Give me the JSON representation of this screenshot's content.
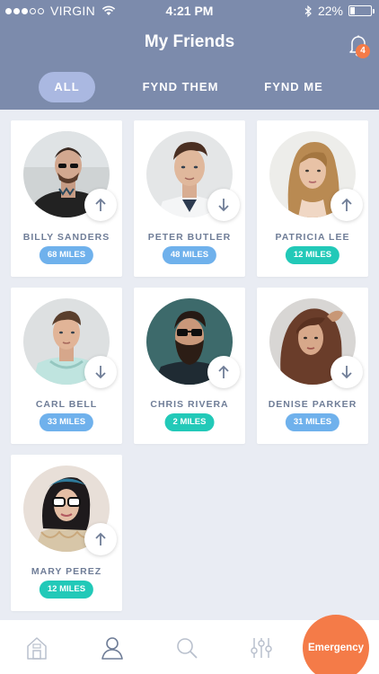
{
  "status_bar": {
    "carrier": "VIRGIN",
    "time": "4:21 PM",
    "battery": "22%",
    "battery_level": 0.22
  },
  "header": {
    "title": "My Friends",
    "notification_count": "4"
  },
  "tabs": [
    {
      "label": "ALL",
      "active": true
    },
    {
      "label": "FYND THEM",
      "active": false
    },
    {
      "label": "FYND ME",
      "active": false
    }
  ],
  "friends": [
    {
      "name": "BILLY SANDERS",
      "miles": "68 MILES",
      "direction": "up",
      "badge_color": "#6fb1ec"
    },
    {
      "name": "PETER BUTLER",
      "miles": "48 MILES",
      "direction": "down",
      "badge_color": "#6fb1ec"
    },
    {
      "name": "PATRICIA LEE",
      "miles": "12 MILES",
      "direction": "up",
      "badge_color": "#22c9b8"
    },
    {
      "name": "CARL BELL",
      "miles": "33 MILES",
      "direction": "down",
      "badge_color": "#6fb1ec"
    },
    {
      "name": "CHRIS RIVERA",
      "miles": "2 MILES",
      "direction": "up",
      "badge_color": "#22c9b8"
    },
    {
      "name": "DENISE PARKER",
      "miles": "31 MILES",
      "direction": "down",
      "badge_color": "#6fb1ec"
    },
    {
      "name": "MARY PEREZ",
      "miles": "12 MILES",
      "direction": "up",
      "badge_color": "#22c9b8"
    }
  ],
  "bottom_nav": {
    "items": [
      "home-icon",
      "profile-icon",
      "search-icon",
      "filters-icon"
    ],
    "emergency_label": "Emergency"
  },
  "colors": {
    "header_bg": "#7c8bac",
    "active_tab": "#aab8e1",
    "accent": "#f47b48",
    "miles_blue": "#6fb1ec",
    "miles_teal": "#22c9b8"
  }
}
